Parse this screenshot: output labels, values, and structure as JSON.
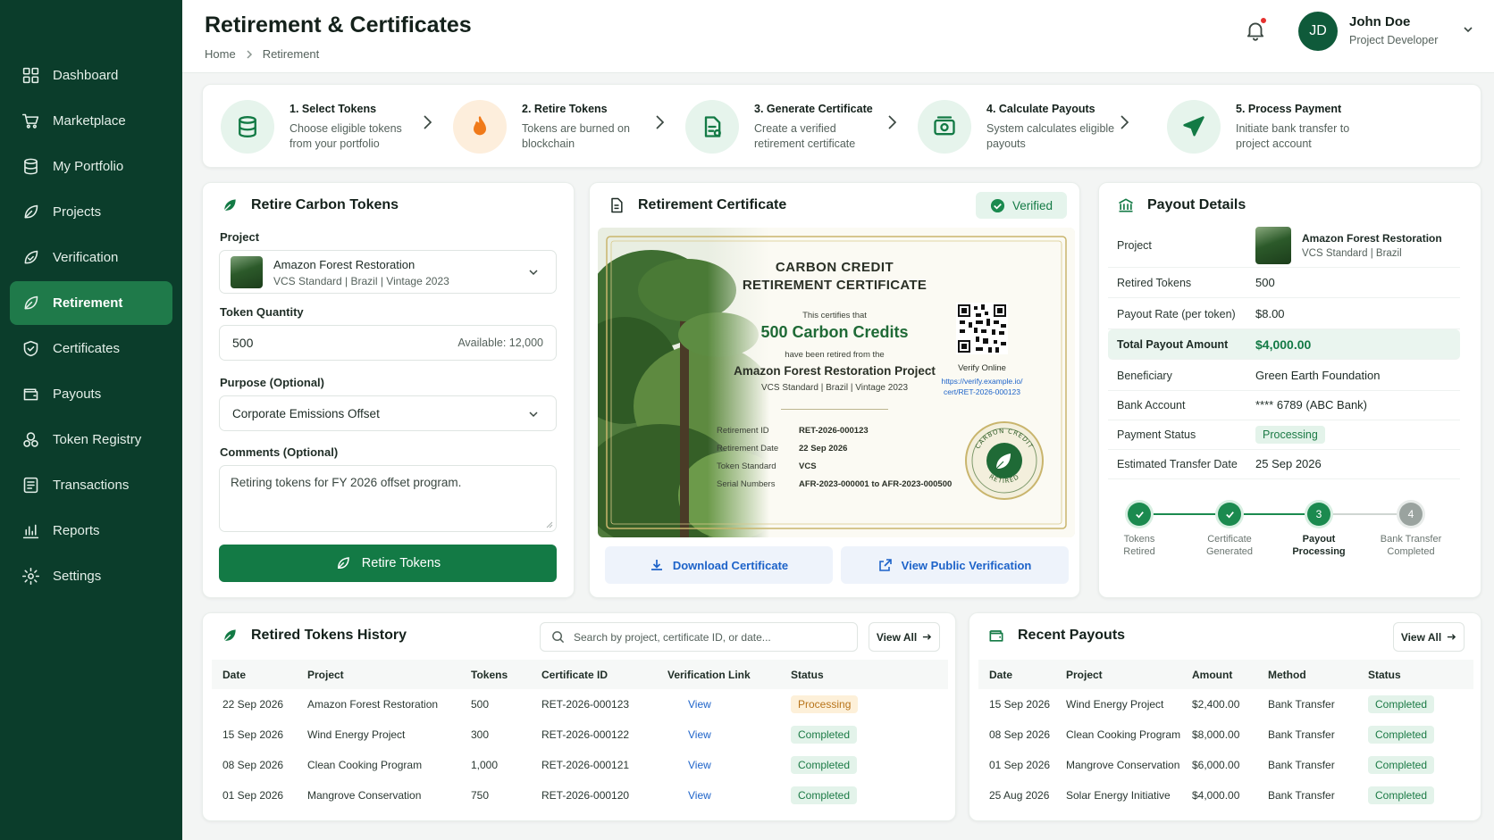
{
  "sidebar": {
    "items": [
      {
        "label": "Dashboard",
        "icon": "grid-icon"
      },
      {
        "label": "Marketplace",
        "icon": "cart-icon"
      },
      {
        "label": "My Portfolio",
        "icon": "database-icon"
      },
      {
        "label": "Projects",
        "icon": "leaf-icon"
      },
      {
        "label": "Verification",
        "icon": "leaf-check-icon"
      },
      {
        "label": "Retirement",
        "icon": "leaf-icon",
        "active": true
      },
      {
        "label": "Certificates",
        "icon": "shield-check-icon"
      },
      {
        "label": "Payouts",
        "icon": "wallet-icon"
      },
      {
        "label": "Token Registry",
        "icon": "token-icon"
      },
      {
        "label": "Transactions",
        "icon": "list-icon"
      },
      {
        "label": "Reports",
        "icon": "bar-chart-icon"
      },
      {
        "label": "Settings",
        "icon": "gear-icon"
      }
    ]
  },
  "header": {
    "title": "Retirement & Certificates",
    "breadcrumb": [
      "Home",
      "Retirement"
    ],
    "user": {
      "initials": "JD",
      "name": "John Doe",
      "role": "Project Developer"
    }
  },
  "steps": [
    {
      "title": "1. Select Tokens",
      "desc": "Choose eligible tokens from your portfolio",
      "icon": "database-icon"
    },
    {
      "title": "2. Retire Tokens",
      "desc": "Tokens are burned on blockchain",
      "icon": "flame-icon"
    },
    {
      "title": "3. Generate Certificate",
      "desc": "Create a verified retirement certificate",
      "icon": "document-icon"
    },
    {
      "title": "4. Calculate Payouts",
      "desc": "System calculates eligible payouts",
      "icon": "money-icon"
    },
    {
      "title": "5. Process Payment",
      "desc": "Initiate bank transfer to project account",
      "icon": "send-icon"
    }
  ],
  "retire": {
    "title": "Retire Carbon Tokens",
    "project_label": "Project",
    "project_name": "Amazon Forest Restoration",
    "project_meta": "VCS Standard | Brazil | Vintage 2023",
    "qty_label": "Token Quantity",
    "qty_value": "500",
    "available": "Available: 12,000",
    "purpose_label": "Purpose (Optional)",
    "purpose_value": "Corporate Emissions Offset",
    "comments_label": "Comments (Optional)",
    "comments_value": "Retiring tokens for FY 2026 offset program.",
    "button": "Retire Tokens"
  },
  "certificate": {
    "title": "Retirement Certificate",
    "badge": "Verified",
    "heading1": "CARBON CREDIT",
    "heading2": "RETIREMENT CERTIFICATE",
    "certifies": "This certifies that",
    "credits": "500 Carbon Credits",
    "retired_from": "have been retired from the",
    "project": "Amazon Forest Restoration Project",
    "meta": "VCS Standard | Brazil | Vintage 2023",
    "verify_online": "Verify Online",
    "verify_url1": "https://verify.example.io/",
    "verify_url2": "cert/RET-2026-000123",
    "fields": [
      {
        "k": "Retirement ID",
        "v": "RET-2026-000123"
      },
      {
        "k": "Retirement Date",
        "v": "22 Sep 2026"
      },
      {
        "k": "Token Standard",
        "v": "VCS"
      },
      {
        "k": "Serial Numbers",
        "v": "AFR-2023-000001 to AFR-2023-000500"
      }
    ],
    "seal_top": "CARBON CREDIT",
    "seal_bottom": "RETIRED",
    "download": "Download Certificate",
    "view_public": "View Public Verification"
  },
  "payout": {
    "title": "Payout Details",
    "project_label": "Project",
    "project_name": "Amazon Forest Restoration",
    "project_meta": "VCS Standard | Brazil",
    "rows": [
      {
        "k": "Retired Tokens",
        "v": "500"
      },
      {
        "k": "Payout Rate (per token)",
        "v": "$8.00"
      },
      {
        "k": "Total Payout Amount",
        "v": "$4,000.00"
      },
      {
        "k": "Beneficiary",
        "v": "Green Earth Foundation"
      },
      {
        "k": "Bank Account",
        "v": "**** 6789 (ABC Bank)"
      },
      {
        "k": "Payment Status",
        "v": "Processing"
      },
      {
        "k": "Estimated Transfer Date",
        "v": "25 Sep 2026"
      }
    ],
    "progress": [
      {
        "l1": "Tokens",
        "l2": "Retired",
        "state": "done"
      },
      {
        "l1": "Certificate",
        "l2": "Generated",
        "state": "done"
      },
      {
        "l1": "Payout",
        "l2": "Processing",
        "state": "current",
        "n": "3"
      },
      {
        "l1": "Bank Transfer",
        "l2": "Completed",
        "state": "todo",
        "n": "4"
      }
    ]
  },
  "history": {
    "title": "Retired Tokens History",
    "search_placeholder": "Search by project, certificate ID, or date...",
    "view_all": "View All",
    "columns": [
      "Date",
      "Project",
      "Tokens",
      "Certificate ID",
      "Verification Link",
      "Status"
    ],
    "rows": [
      [
        "22 Sep 2026",
        "Amazon Forest Restoration",
        "500",
        "RET-2026-000123",
        "View",
        "Processing"
      ],
      [
        "15 Sep 2026",
        "Wind Energy Project",
        "300",
        "RET-2026-000122",
        "View",
        "Completed"
      ],
      [
        "08 Sep 2026",
        "Clean Cooking Program",
        "1,000",
        "RET-2026-000121",
        "View",
        "Completed"
      ],
      [
        "01 Sep 2026",
        "Mangrove Conservation",
        "750",
        "RET-2026-000120",
        "View",
        "Completed"
      ]
    ]
  },
  "payouts": {
    "title": "Recent Payouts",
    "view_all": "View All",
    "columns": [
      "Date",
      "Project",
      "Amount",
      "Method",
      "Status"
    ],
    "rows": [
      [
        "15 Sep 2026",
        "Wind Energy Project",
        "$2,400.00",
        "Bank Transfer",
        "Completed"
      ],
      [
        "08 Sep 2026",
        "Clean Cooking Program",
        "$8,000.00",
        "Bank Transfer",
        "Completed"
      ],
      [
        "01 Sep 2026",
        "Mangrove Conservation",
        "$6,000.00",
        "Bank Transfer",
        "Completed"
      ],
      [
        "25 Aug 2026",
        "Solar Energy Initiative",
        "$4,000.00",
        "Bank Transfer",
        "Completed"
      ]
    ]
  },
  "colors": {
    "sidebar": "#0b3d2b",
    "accent": "#137a45",
    "active": "#1f7a4a",
    "link": "#1d63c9"
  }
}
